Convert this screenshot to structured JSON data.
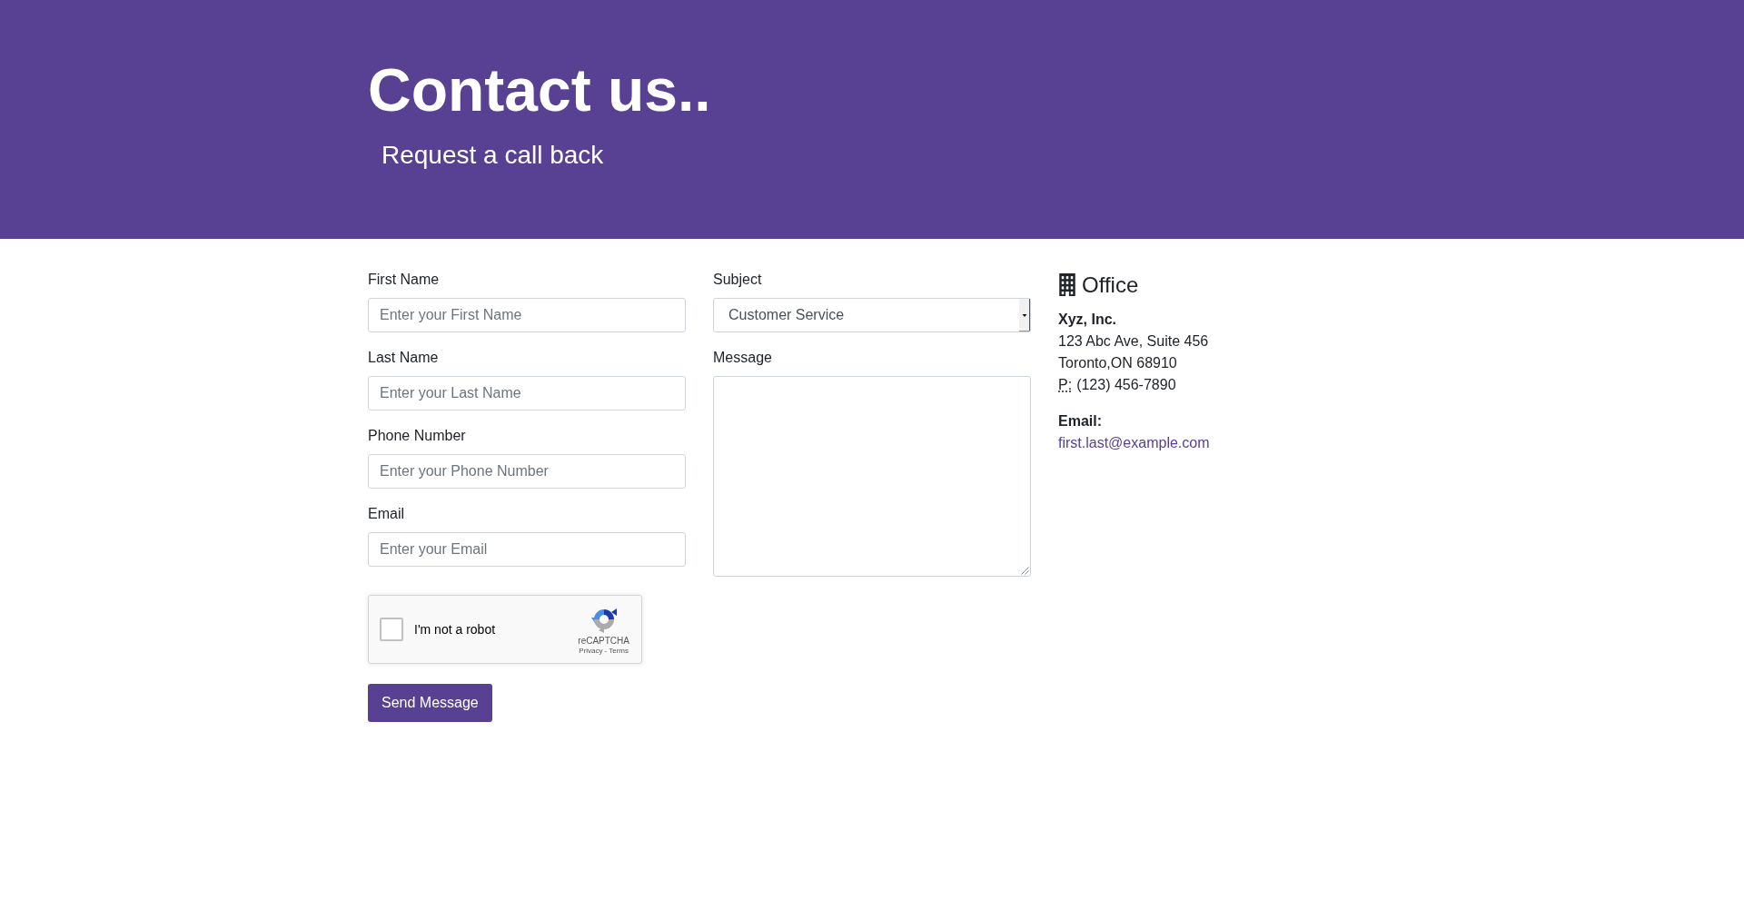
{
  "header": {
    "title": "Contact us..",
    "subtitle": "Request a call back"
  },
  "form": {
    "fields": [
      {
        "label": "First Name",
        "placeholder": "Enter your First Name"
      },
      {
        "label": "Last Name",
        "placeholder": "Enter your Last Name"
      },
      {
        "label": "Phone Number",
        "placeholder": "Enter your Phone Number"
      },
      {
        "label": "Email",
        "placeholder": "Enter your Email"
      }
    ],
    "recaptcha": {
      "label": "I'm not a robot",
      "checked": false,
      "brand": "reCAPTCHA",
      "links": [
        "Privacy",
        "Terms"
      ],
      "separator": "-"
    },
    "submit_button": "Send Message",
    "subject": {
      "label": "Subject",
      "value": "Customer Service"
    },
    "message": {
      "label": "Message"
    }
  },
  "office": {
    "title": "Office",
    "company": "Xyz, Inc.",
    "address_lines": [
      "123 Abc Ave, Suite 456",
      "Toronto,ON 68910"
    ],
    "phone": {
      "label": "P:",
      "number": "(123) 456-7890"
    },
    "email": {
      "label": "Email:",
      "address": "first.last@example.com"
    }
  }
}
